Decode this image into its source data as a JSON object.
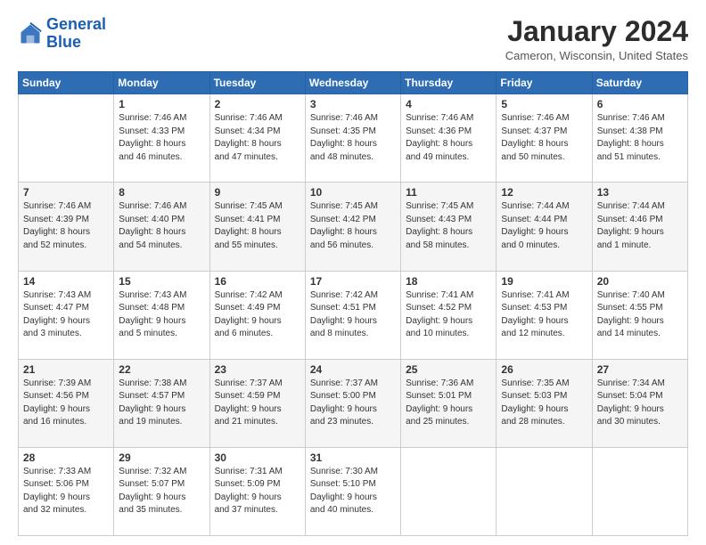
{
  "logo": {
    "line1": "General",
    "line2": "Blue"
  },
  "title": "January 2024",
  "location": "Cameron, Wisconsin, United States",
  "days_header": [
    "Sunday",
    "Monday",
    "Tuesday",
    "Wednesday",
    "Thursday",
    "Friday",
    "Saturday"
  ],
  "weeks": [
    [
      {
        "num": "",
        "info": ""
      },
      {
        "num": "1",
        "info": "Sunrise: 7:46 AM\nSunset: 4:33 PM\nDaylight: 8 hours\nand 46 minutes."
      },
      {
        "num": "2",
        "info": "Sunrise: 7:46 AM\nSunset: 4:34 PM\nDaylight: 8 hours\nand 47 minutes."
      },
      {
        "num": "3",
        "info": "Sunrise: 7:46 AM\nSunset: 4:35 PM\nDaylight: 8 hours\nand 48 minutes."
      },
      {
        "num": "4",
        "info": "Sunrise: 7:46 AM\nSunset: 4:36 PM\nDaylight: 8 hours\nand 49 minutes."
      },
      {
        "num": "5",
        "info": "Sunrise: 7:46 AM\nSunset: 4:37 PM\nDaylight: 8 hours\nand 50 minutes."
      },
      {
        "num": "6",
        "info": "Sunrise: 7:46 AM\nSunset: 4:38 PM\nDaylight: 8 hours\nand 51 minutes."
      }
    ],
    [
      {
        "num": "7",
        "info": "Sunrise: 7:46 AM\nSunset: 4:39 PM\nDaylight: 8 hours\nand 52 minutes."
      },
      {
        "num": "8",
        "info": "Sunrise: 7:46 AM\nSunset: 4:40 PM\nDaylight: 8 hours\nand 54 minutes."
      },
      {
        "num": "9",
        "info": "Sunrise: 7:45 AM\nSunset: 4:41 PM\nDaylight: 8 hours\nand 55 minutes."
      },
      {
        "num": "10",
        "info": "Sunrise: 7:45 AM\nSunset: 4:42 PM\nDaylight: 8 hours\nand 56 minutes."
      },
      {
        "num": "11",
        "info": "Sunrise: 7:45 AM\nSunset: 4:43 PM\nDaylight: 8 hours\nand 58 minutes."
      },
      {
        "num": "12",
        "info": "Sunrise: 7:44 AM\nSunset: 4:44 PM\nDaylight: 9 hours\nand 0 minutes."
      },
      {
        "num": "13",
        "info": "Sunrise: 7:44 AM\nSunset: 4:46 PM\nDaylight: 9 hours\nand 1 minute."
      }
    ],
    [
      {
        "num": "14",
        "info": "Sunrise: 7:43 AM\nSunset: 4:47 PM\nDaylight: 9 hours\nand 3 minutes."
      },
      {
        "num": "15",
        "info": "Sunrise: 7:43 AM\nSunset: 4:48 PM\nDaylight: 9 hours\nand 5 minutes."
      },
      {
        "num": "16",
        "info": "Sunrise: 7:42 AM\nSunset: 4:49 PM\nDaylight: 9 hours\nand 6 minutes."
      },
      {
        "num": "17",
        "info": "Sunrise: 7:42 AM\nSunset: 4:51 PM\nDaylight: 9 hours\nand 8 minutes."
      },
      {
        "num": "18",
        "info": "Sunrise: 7:41 AM\nSunset: 4:52 PM\nDaylight: 9 hours\nand 10 minutes."
      },
      {
        "num": "19",
        "info": "Sunrise: 7:41 AM\nSunset: 4:53 PM\nDaylight: 9 hours\nand 12 minutes."
      },
      {
        "num": "20",
        "info": "Sunrise: 7:40 AM\nSunset: 4:55 PM\nDaylight: 9 hours\nand 14 minutes."
      }
    ],
    [
      {
        "num": "21",
        "info": "Sunrise: 7:39 AM\nSunset: 4:56 PM\nDaylight: 9 hours\nand 16 minutes."
      },
      {
        "num": "22",
        "info": "Sunrise: 7:38 AM\nSunset: 4:57 PM\nDaylight: 9 hours\nand 19 minutes."
      },
      {
        "num": "23",
        "info": "Sunrise: 7:37 AM\nSunset: 4:59 PM\nDaylight: 9 hours\nand 21 minutes."
      },
      {
        "num": "24",
        "info": "Sunrise: 7:37 AM\nSunset: 5:00 PM\nDaylight: 9 hours\nand 23 minutes."
      },
      {
        "num": "25",
        "info": "Sunrise: 7:36 AM\nSunset: 5:01 PM\nDaylight: 9 hours\nand 25 minutes."
      },
      {
        "num": "26",
        "info": "Sunrise: 7:35 AM\nSunset: 5:03 PM\nDaylight: 9 hours\nand 28 minutes."
      },
      {
        "num": "27",
        "info": "Sunrise: 7:34 AM\nSunset: 5:04 PM\nDaylight: 9 hours\nand 30 minutes."
      }
    ],
    [
      {
        "num": "28",
        "info": "Sunrise: 7:33 AM\nSunset: 5:06 PM\nDaylight: 9 hours\nand 32 minutes."
      },
      {
        "num": "29",
        "info": "Sunrise: 7:32 AM\nSunset: 5:07 PM\nDaylight: 9 hours\nand 35 minutes."
      },
      {
        "num": "30",
        "info": "Sunrise: 7:31 AM\nSunset: 5:09 PM\nDaylight: 9 hours\nand 37 minutes."
      },
      {
        "num": "31",
        "info": "Sunrise: 7:30 AM\nSunset: 5:10 PM\nDaylight: 9 hours\nand 40 minutes."
      },
      {
        "num": "",
        "info": ""
      },
      {
        "num": "",
        "info": ""
      },
      {
        "num": "",
        "info": ""
      }
    ]
  ]
}
